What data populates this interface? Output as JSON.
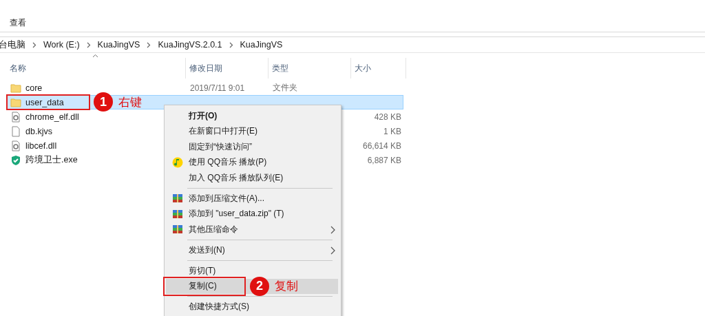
{
  "menu_bar": {
    "items": [
      {
        "label": "查看"
      }
    ]
  },
  "breadcrumb": [
    "台电脑",
    "Work (E:)",
    "KuaJingVS",
    "KuaJingVS.2.0.1",
    "KuaJingVS"
  ],
  "table": {
    "columns": [
      "名称",
      "修改日期",
      "类型",
      "大小"
    ],
    "rows": [
      {
        "kind": "folder",
        "name": "core",
        "date": "2019/7/11 9:01",
        "type": "文件夹",
        "selected": false,
        "marked": false
      },
      {
        "kind": "folder",
        "name": "user_data",
        "selected": true,
        "marked": true
      },
      {
        "kind": "dll",
        "name": "chrome_elf.dll",
        "size": "428 KB",
        "selected": false,
        "marked": false
      },
      {
        "kind": "file",
        "name": "db.kjvs",
        "size": "1 KB",
        "selected": false,
        "marked": false
      },
      {
        "kind": "dll",
        "name": "libcef.dll",
        "size": "66,614 KB",
        "selected": false,
        "marked": false
      },
      {
        "kind": "shield",
        "name": "跨境卫士.exe",
        "size": "6,887 KB",
        "selected": false,
        "marked": false
      }
    ]
  },
  "context_menu": {
    "items": [
      {
        "kind": "default",
        "label": "打开(O)",
        "selected": false,
        "marked": false,
        "submenu": false
      },
      {
        "kind": "plain",
        "label": "在新窗口中打开(E)",
        "selected": false,
        "marked": false,
        "submenu": false
      },
      {
        "kind": "plain",
        "label": "固定到“快速访问”",
        "selected": false,
        "marked": false,
        "submenu": false
      },
      {
        "kind": "music",
        "label": "使用 QQ音乐 播放(P)",
        "selected": false,
        "marked": false,
        "submenu": false
      },
      {
        "kind": "plain",
        "label": "加入 QQ音乐 播放队列(E)",
        "selected": false,
        "marked": false,
        "submenu": false
      },
      {
        "kind": "separator"
      },
      {
        "kind": "archive",
        "label": "添加到压缩文件(A)...",
        "selected": false,
        "marked": false,
        "submenu": false
      },
      {
        "kind": "archive",
        "label": "添加到 \"user_data.zip\" (T)",
        "selected": false,
        "marked": false,
        "submenu": false
      },
      {
        "kind": "archive",
        "label": "其他压缩命令",
        "selected": false,
        "marked": false,
        "submenu": true
      },
      {
        "kind": "separator"
      },
      {
        "kind": "plain",
        "label": "发送到(N)",
        "selected": false,
        "marked": false,
        "submenu": true
      },
      {
        "kind": "separator"
      },
      {
        "kind": "plain",
        "label": "剪切(T)",
        "selected": false,
        "marked": false,
        "submenu": false
      },
      {
        "kind": "plain",
        "label": "复制(C)",
        "selected": true,
        "marked": true,
        "submenu": false
      },
      {
        "kind": "separator"
      },
      {
        "kind": "plain",
        "label": "创建快捷方式(S)",
        "selected": false,
        "marked": false,
        "submenu": false
      }
    ]
  },
  "annotations": [
    {
      "number": "1",
      "label": "右键"
    },
    {
      "number": "2",
      "label": "复制"
    }
  ]
}
